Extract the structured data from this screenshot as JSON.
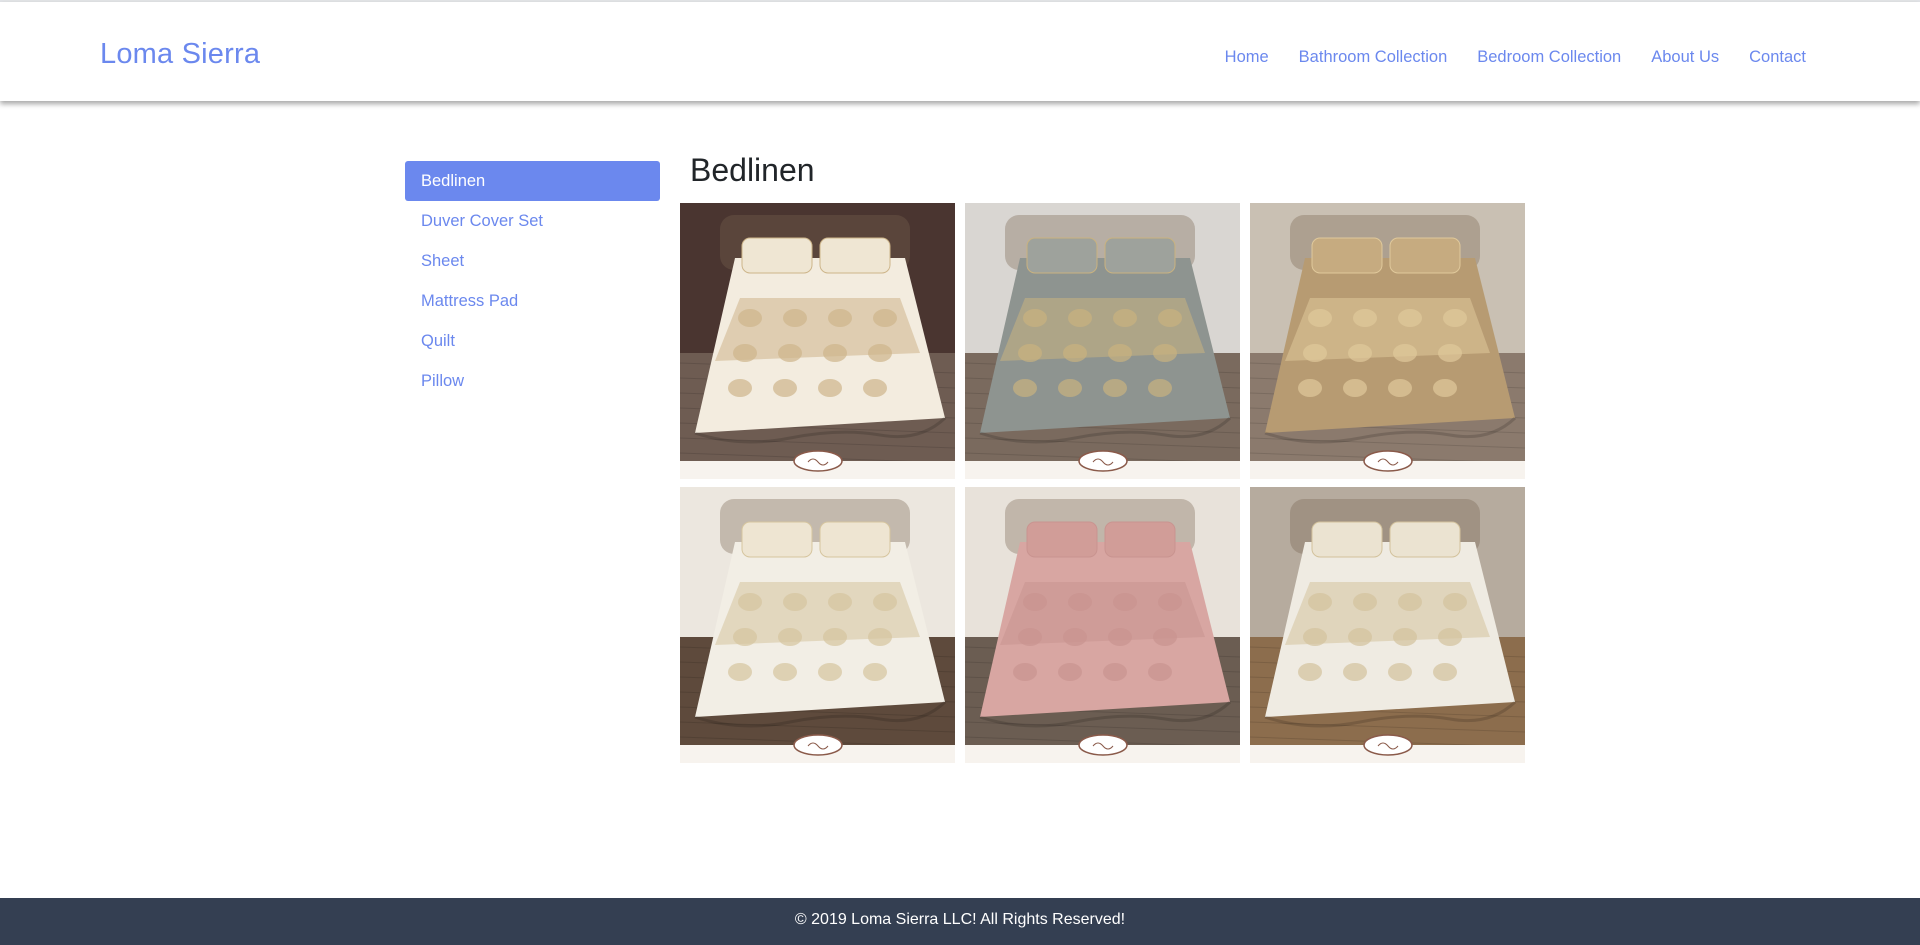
{
  "brand": "Loma Sierra",
  "nav": [
    "Home",
    "Bathroom Collection",
    "Bedroom Collection",
    "About Us",
    "Contact"
  ],
  "sidebar": {
    "items": [
      {
        "label": "Bedlinen",
        "active": true
      },
      {
        "label": "Duver Cover Set",
        "active": false
      },
      {
        "label": "Sheet",
        "active": false
      },
      {
        "label": "Mattress Pad",
        "active": false
      },
      {
        "label": "Quilt",
        "active": false
      },
      {
        "label": "Pillow",
        "active": false
      }
    ]
  },
  "main": {
    "title": "Bedlinen",
    "products": [
      {
        "wall": "#4a3530",
        "floor": "#6e5c52",
        "spread": "#f3ecdf",
        "pattern": "#cdb58a",
        "pillow": "#efe6d3"
      },
      {
        "wall": "#d9d6d2",
        "floor": "#7a6a5e",
        "spread": "#8e9490",
        "pattern": "#c9b27f",
        "pillow": "#9ea29c"
      },
      {
        "wall": "#c9c0b3",
        "floor": "#8b7a6d",
        "spread": "#b79b72",
        "pattern": "#e0c99b",
        "pillow": "#c6ab80"
      },
      {
        "wall": "#ece7df",
        "floor": "#5e4a3c",
        "spread": "#f2eee5",
        "pattern": "#d6c59e",
        "pillow": "#eee5d2"
      },
      {
        "wall": "#e8e2da",
        "floor": "#6b5d52",
        "spread": "#d8a6a2",
        "pattern": "#c99490",
        "pillow": "#d19d98"
      },
      {
        "wall": "#b6ab9e",
        "floor": "#8c6d4d",
        "spread": "#efebe2",
        "pattern": "#d3c29c",
        "pillow": "#ebe3d1"
      }
    ]
  },
  "footer": {
    "text": "© 2019 Loma Sierra LLC! All Rights Reserved!"
  }
}
